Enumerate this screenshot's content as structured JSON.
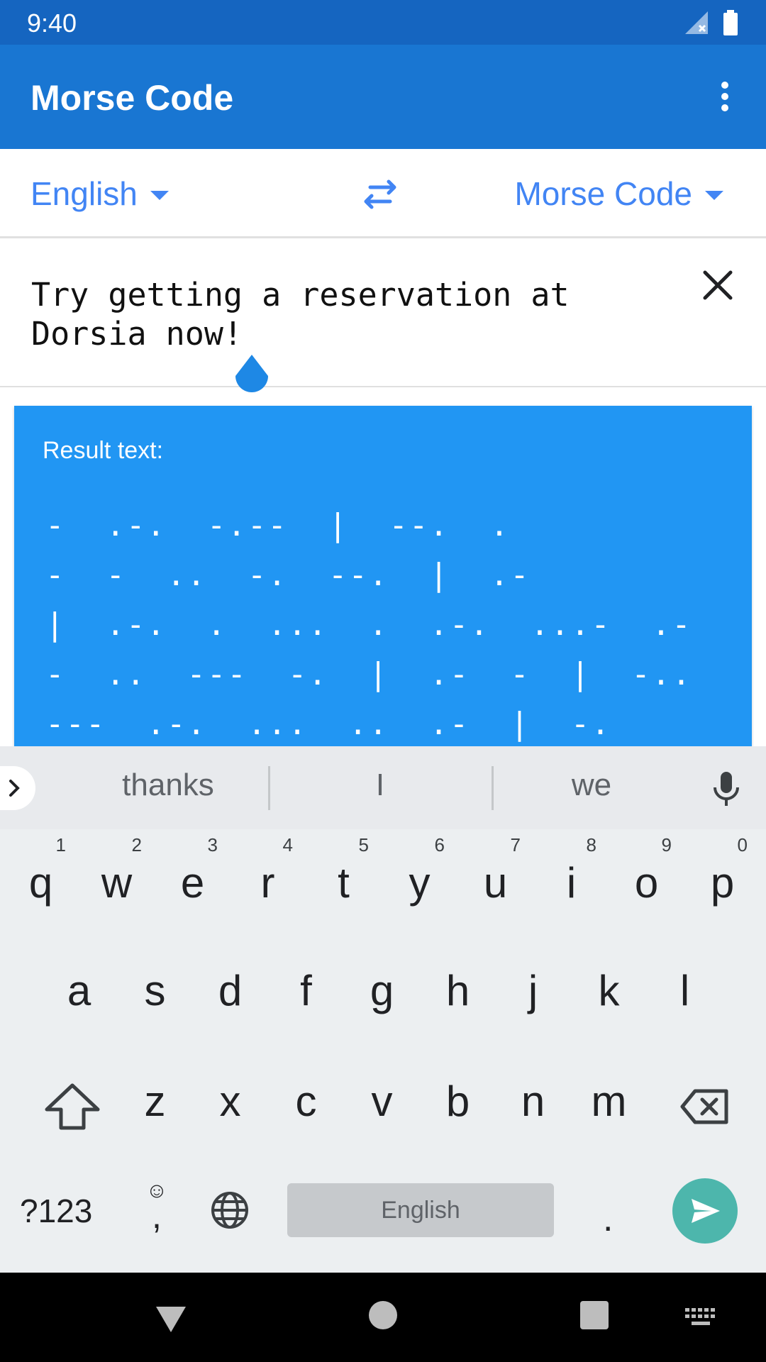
{
  "status_bar": {
    "time": "9:40"
  },
  "app_bar": {
    "title": "Morse Code"
  },
  "languages": {
    "source": "English",
    "target": "Morse Code"
  },
  "input": {
    "text": "Try getting a reservation at\nDorsia now!"
  },
  "result": {
    "label": "Result text:",
    "text": "-  .-.  -.--  |  --.  .\n-  -  ..  -.  --.  |  .-\n|  .-.  .  ...  .  .-.  ...-  .-\n-  ..  ---  -.  |  .-  -  |  -..\n---  .-.  ...  ..  .-  |  -."
  },
  "keyboard": {
    "suggestions": [
      "thanks",
      "I",
      "we"
    ],
    "row1": [
      {
        "letter": "q",
        "hint": "1"
      },
      {
        "letter": "w",
        "hint": "2"
      },
      {
        "letter": "e",
        "hint": "3"
      },
      {
        "letter": "r",
        "hint": "4"
      },
      {
        "letter": "t",
        "hint": "5"
      },
      {
        "letter": "y",
        "hint": "6"
      },
      {
        "letter": "u",
        "hint": "7"
      },
      {
        "letter": "i",
        "hint": "8"
      },
      {
        "letter": "o",
        "hint": "9"
      },
      {
        "letter": "p",
        "hint": "0"
      }
    ],
    "row2": [
      "a",
      "s",
      "d",
      "f",
      "g",
      "h",
      "j",
      "k",
      "l"
    ],
    "row3": [
      "z",
      "x",
      "c",
      "v",
      "b",
      "n",
      "m"
    ],
    "symbols_label": "?123",
    "comma_label": ",",
    "emoji_label": "☺",
    "space_label": "English",
    "period_label": "."
  },
  "colors": {
    "status_bar": "#1565c0",
    "app_bar": "#1976d2",
    "accent": "#4285f4",
    "result_card": "#2196f3",
    "send": "#4db6ac"
  }
}
